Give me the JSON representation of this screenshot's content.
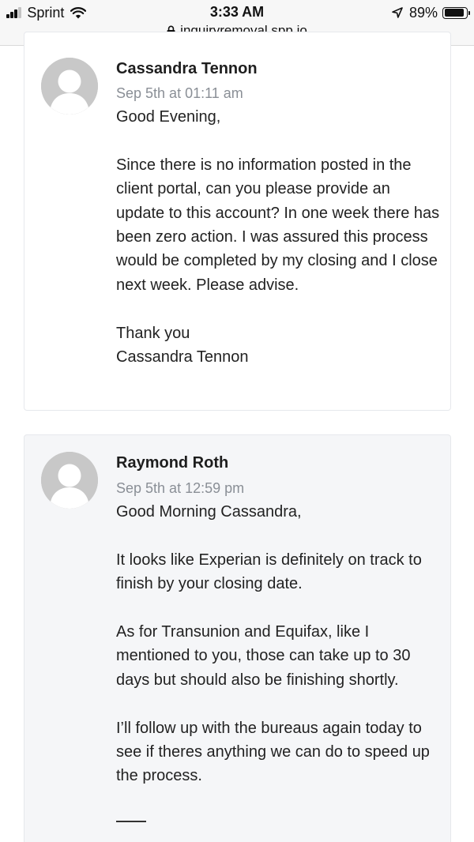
{
  "status_bar": {
    "carrier": "Sprint",
    "time": "3:33 AM",
    "battery": "89%",
    "battery_level": 0.89,
    "url": "inquiryremoval.spp.io"
  },
  "comments": [
    {
      "author": "Cassandra Tennon",
      "date": "Sep 5th at 01:11 am",
      "paragraphs": [
        "Good Evening,",
        "Since there is no information posted in the client portal, can you please provide an update to this account? In one week there has been zero action. I was assured this process would be completed by my closing and I close next week. Please advise.",
        "Thank you\nCassandra Tennon"
      ]
    },
    {
      "author": "Raymond Roth",
      "date": "Sep 5th at 12:59 pm",
      "paragraphs": [
        "Good Morning Cassandra,",
        "It looks like Experian is definitely on track to finish by your closing date.",
        "As for Transunion and Equifax, like I mentioned to you, those can take up to 30 days but should also be finishing shortly.",
        "I’ll follow up with the bureaus again today to see if theres anything we can do to speed up the process."
      ]
    }
  ]
}
